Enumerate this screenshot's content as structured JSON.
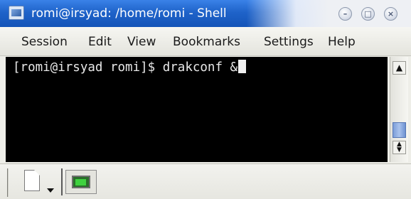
{
  "window": {
    "title": "romi@irsyad: /home/romi - Shell"
  },
  "controls": {
    "minimize_glyph": "–",
    "maximize_glyph": "□",
    "close_glyph": "×"
  },
  "menu": {
    "items": [
      "Session",
      "Edit",
      "View",
      "Bookmarks",
      "Settings",
      "Help"
    ]
  },
  "terminal": {
    "prompt": "[romi@irsyad romi]$ ",
    "command": "drakconf &"
  },
  "scrollbar": {
    "up_glyph": "▲",
    "down_glyph": "▼"
  },
  "icons": {
    "app": "konsole-icon",
    "new_session": "new-session-icon",
    "session_tab": "shell-session-icon"
  },
  "colors": {
    "titlebar": "#1f63c9",
    "terminal_bg": "#000000",
    "terminal_fg": "#e8e8e8",
    "session_screen": "#3fd23f"
  }
}
